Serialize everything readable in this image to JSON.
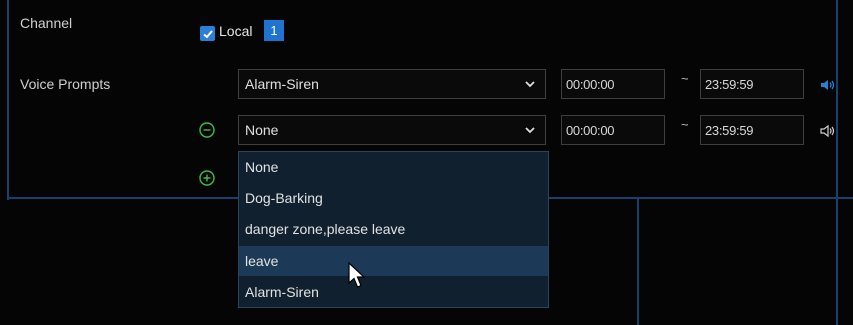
{
  "channel": {
    "label": "Channel",
    "local_label": "Local",
    "local_checked": true,
    "channel_number": "1"
  },
  "voice_prompts": {
    "label": "Voice Prompts",
    "rows": [
      {
        "selected": "Alarm-Siren",
        "start": "00:00:00",
        "separator": "~",
        "end": "23:59:59",
        "speaker_active": true
      },
      {
        "selected": "None",
        "start": "00:00:00",
        "separator": "~",
        "end": "23:59:59",
        "speaker_active": false
      }
    ]
  },
  "dropdown": {
    "options": [
      "None",
      "Dog-Barking",
      "danger zone,please leave",
      "leave",
      "Alarm-Siren"
    ],
    "highlighted": "leave"
  },
  "colors": {
    "accent": "#2b7fd6",
    "frame": "#1a3f6e",
    "add_remove": "#3fbf3f",
    "speaker_active": "#2b7fd6"
  }
}
